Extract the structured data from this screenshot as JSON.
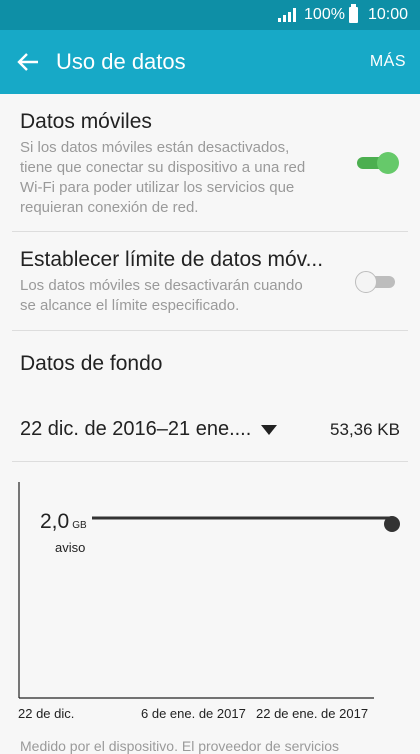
{
  "status": {
    "battery": "100%",
    "time": "10:00"
  },
  "appbar": {
    "title": "Uso de datos",
    "more": "MÁS"
  },
  "mobile": {
    "title": "Datos móviles",
    "desc_lines": [
      "Si los datos móviles están desactivados,",
      "tiene que conectar su dispositivo a una red",
      "Wi-Fi para poder utilizar los servicios que",
      "requieran conexión de red."
    ],
    "enabled": true
  },
  "limit": {
    "title": "Establecer límite de datos móv...",
    "desc_lines": [
      "Los datos móviles se desactivarán cuando",
      "se alcance el límite especificado."
    ],
    "enabled": false
  },
  "background": {
    "title": "Datos de fondo"
  },
  "cycle": {
    "range": "22 dic. de 2016–21 ene....",
    "usage": "53,36 KB"
  },
  "chart_data": {
    "type": "line",
    "warning_value": "2,0",
    "warning_unit": "GB",
    "warning_label": "aviso",
    "x_ticks": [
      "22 de dic.",
      "6 de ene. de 2017",
      "22 de ene. de 2017"
    ]
  },
  "footer": {
    "text": "Medido por el dispositivo. El proveedor de servicios"
  },
  "colors": {
    "appbar": "#17a9c7",
    "statusbar": "#0e8fa6",
    "toggle_on": "#4caf50"
  }
}
